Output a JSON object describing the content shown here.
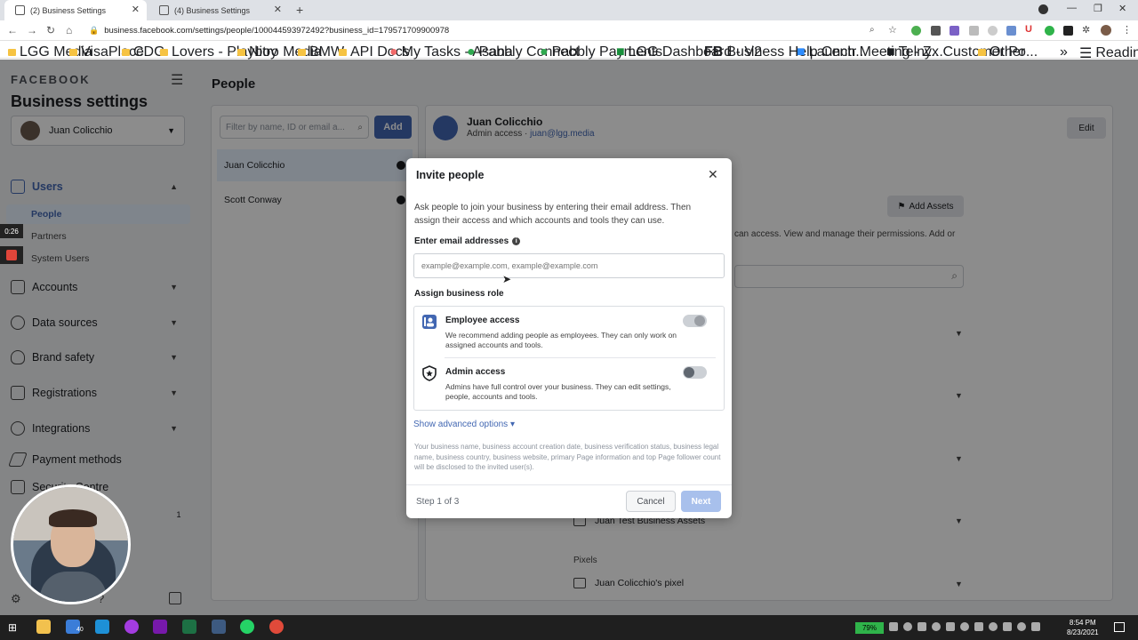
{
  "browser": {
    "tabs": [
      {
        "label": "(2) Business Settings",
        "active": true
      },
      {
        "label": "(4) Business Settings",
        "active": false
      }
    ],
    "url": "business.facebook.com/settings/people/100044593972492?business_id=179571709900978",
    "bookmarks": [
      "LGG Media",
      "VisaPlace",
      "CDG",
      "Lovers - Playboy",
      "Nitro Media",
      "BMW",
      "API Docs",
      "My Tasks - Asana",
      "Pabbly Connect",
      "Pabbly Payments",
      "LGG Dashboard - V2",
      "Business Help Centr...",
      "Launch Meeting - Z...",
      "Telnyx Customer Po...",
      "Other",
      "Reading list"
    ]
  },
  "sidebar": {
    "brand": "FACEBOOK",
    "title": "Business settings",
    "account": "Juan Colicchio",
    "users_label": "Users",
    "subitems": [
      "People",
      "Partners",
      "System Users"
    ],
    "items": [
      "Accounts",
      "Data sources",
      "Brand safety",
      "Registrations",
      "Integrations",
      "Payment methods",
      "Security Centre"
    ],
    "notif_count": "1"
  },
  "main": {
    "page_title": "People",
    "filter_placeholder": "Filter by name, ID or email a...",
    "add_label": "Add",
    "people": [
      "Juan Colicchio",
      "Scott Conway"
    ],
    "selected": {
      "name": "Juan Colicchio",
      "access": "Admin access · ",
      "email": "juan@lgg.media",
      "edit_label": "Edit"
    },
    "add_assets_label": "Add Assets",
    "partial_text": "can access. View and manage their permissions. Add or",
    "asset_name": "Juan Test Business Assets",
    "pixels_header": "Pixels",
    "pixel_name": "Juan Colicchio's pixel"
  },
  "modal": {
    "title": "Invite people",
    "description": "Ask people to join your business by entering their email address. Then assign their access and which accounts and tools they can use.",
    "email_label": "Enter email addresses",
    "email_placeholder": "example@example.com, example@example.com",
    "role_label": "Assign business role",
    "employee": {
      "name": "Employee access",
      "desc": "We recommend adding people as employees. They can only work on assigned accounts and tools.",
      "on": false
    },
    "admin": {
      "name": "Admin access",
      "desc": "Admins have full control over your business. They can edit settings, people, accounts and tools.",
      "on": false
    },
    "advanced": "Show advanced options ▾",
    "disclaimer": "Your business name, business account creation date, business verification status, business legal name, business country, business website, primary Page information and top Page follower count will be disclosed to the invited user(s).",
    "step": "Step 1 of 3",
    "cancel": "Cancel",
    "next": "Next"
  },
  "recording": {
    "timer": "0:26"
  },
  "taskbar": {
    "battery": "79%",
    "time": "8:54 PM",
    "date": "8/23/2021",
    "mail_badge": "40"
  }
}
